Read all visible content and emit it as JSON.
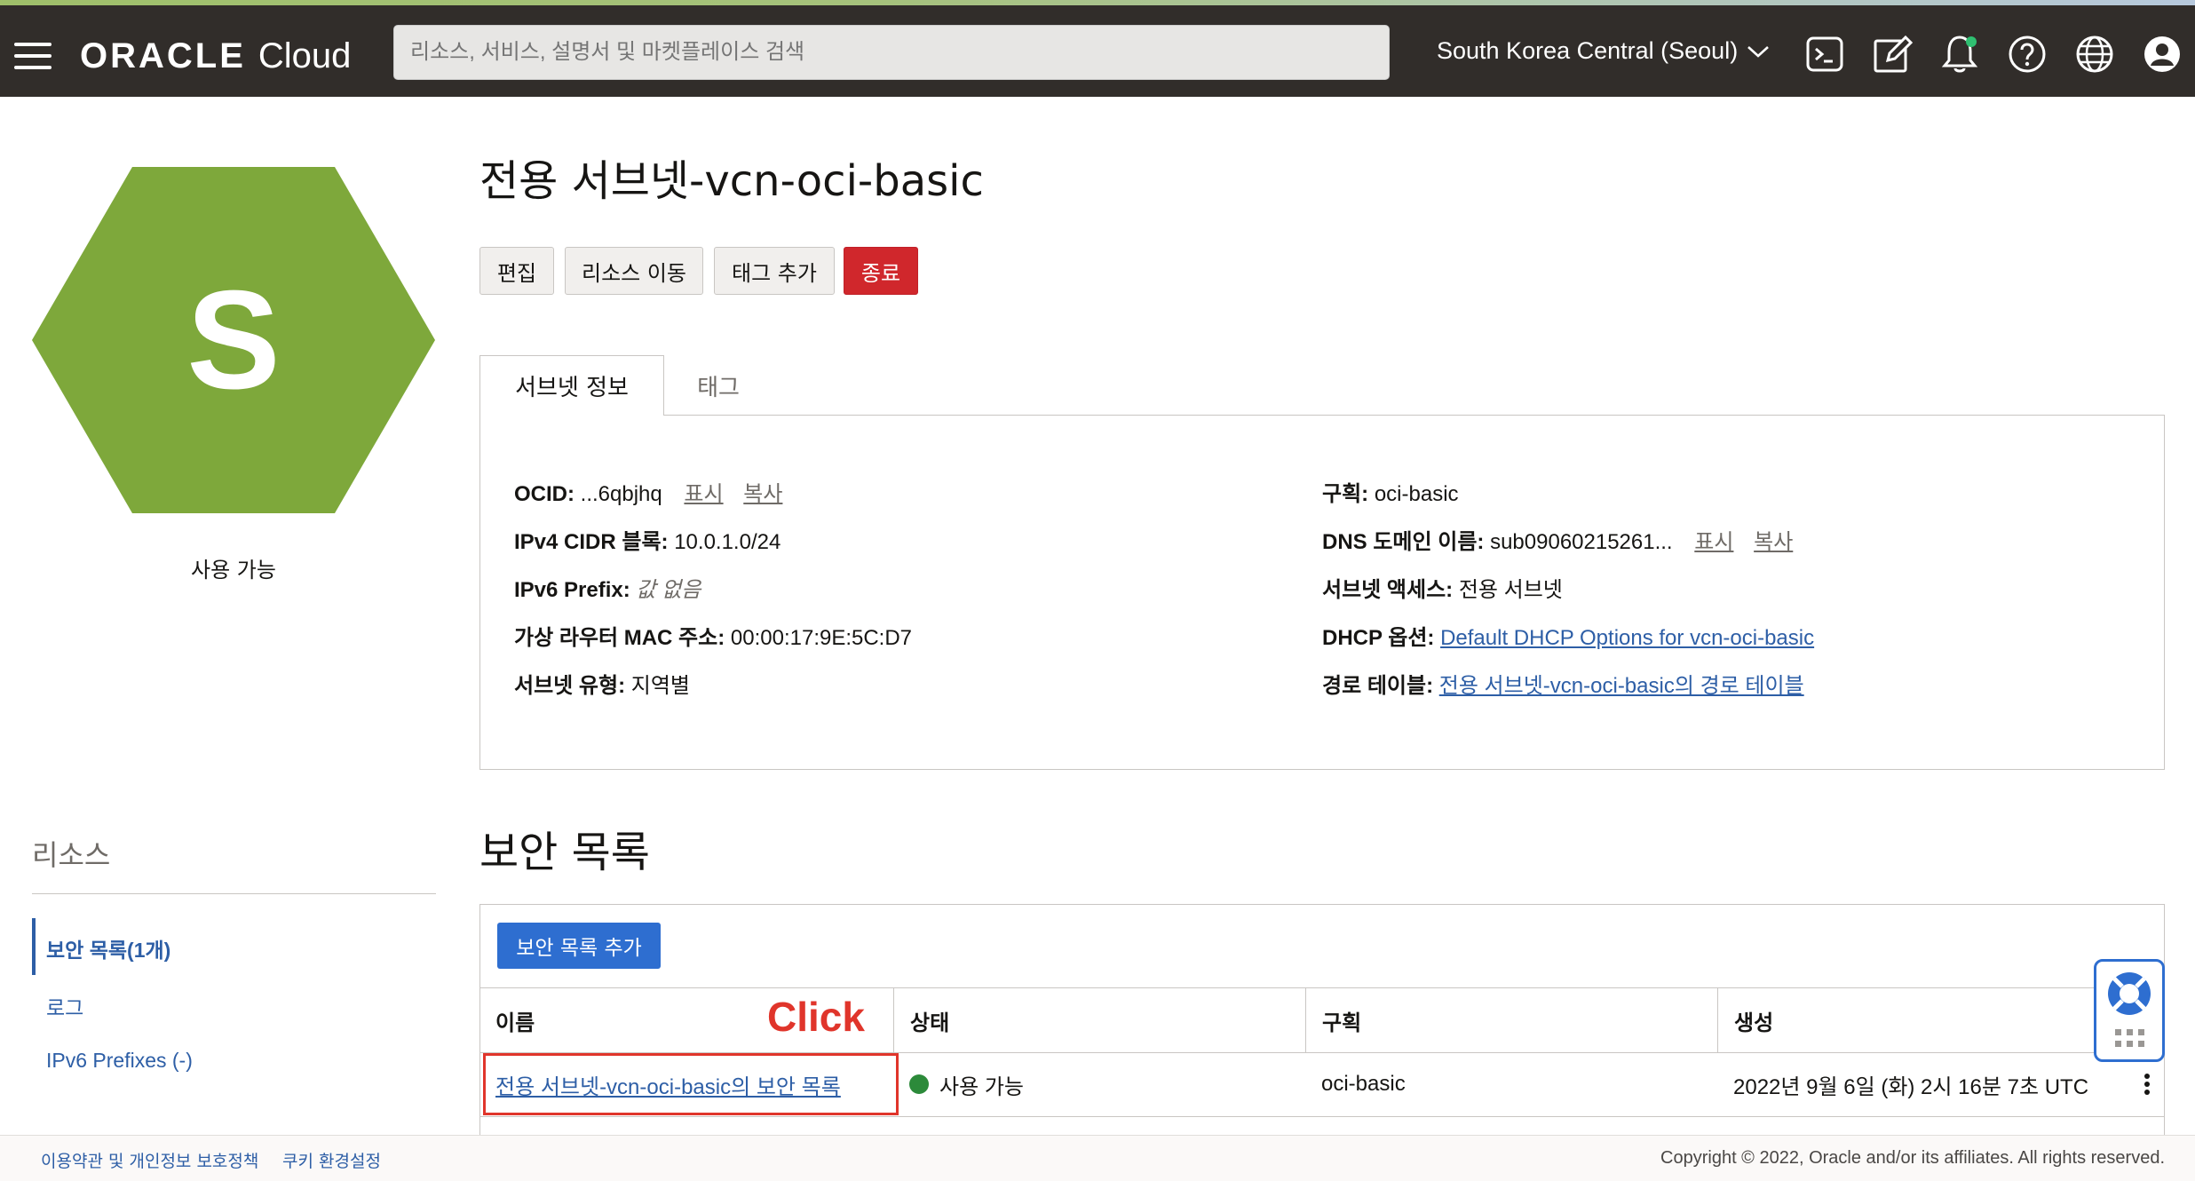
{
  "header": {
    "brand_oracle": "ORACLE",
    "brand_cloud": "Cloud",
    "search_placeholder": "리소스, 서비스, 설명서 및 마켓플레이스 검색",
    "region": "South Korea Central (Seoul)",
    "icons": [
      "cloud-shell-icon",
      "edit-icon",
      "bell-icon",
      "help-icon",
      "globe-icon",
      "user-icon"
    ]
  },
  "summary": {
    "letter": "S",
    "status": "사용 가능",
    "hex_color": "#7ea83b"
  },
  "resources": {
    "heading": "리소스",
    "items": [
      {
        "label": "보안 목록(1개)",
        "active": true
      },
      {
        "label": "로그",
        "active": false
      },
      {
        "label": "IPv6 Prefixes (-)",
        "active": false
      }
    ]
  },
  "page": {
    "title": "전용 서브넷-vcn-oci-basic",
    "actions": {
      "edit": "편집",
      "move": "리소스 이동",
      "add_tags": "태그 추가",
      "terminate": "종료"
    },
    "tabs": {
      "info": "서브넷 정보",
      "tags": "태그"
    }
  },
  "subnet_info": {
    "ocid_label": "OCID:",
    "ocid_value": "...6qbjhq",
    "show": "표시",
    "copy": "복사",
    "ipv4_label": "IPv4 CIDR 블록:",
    "ipv4_value": "10.0.1.0/24",
    "ipv6_label": "IPv6 Prefix:",
    "ipv6_value": "값 없음",
    "mac_label": "가상 라우터 MAC 주소:",
    "mac_value": "00:00:17:9E:5C:D7",
    "type_label": "서브넷 유형:",
    "type_value": "지역별",
    "compartment_label": "구획:",
    "compartment_value": "oci-basic",
    "dns_label": "DNS 도메인 이름:",
    "dns_value": "sub09060215261...",
    "access_label": "서브넷 액세스:",
    "access_value": "전용 서브넷",
    "dhcp_label": "DHCP 옵션:",
    "dhcp_value": "Default DHCP Options for vcn-oci-basic",
    "route_label": "경로 테이블:",
    "route_value": "전용 서브넷-vcn-oci-basic의 경로 테이블"
  },
  "security_lists": {
    "title": "보안 목록",
    "add_button": "보안 목록 추가",
    "click_annotation": "Click",
    "columns": [
      "이름",
      "상태",
      "구획",
      "생성"
    ],
    "rows": [
      {
        "name": "전용 서브넷-vcn-oci-basic의 보안 목록",
        "status": "사용 가능",
        "compartment": "oci-basic",
        "created": "2022년 9월 6일 (화) 2시 16분 7초 UTC"
      }
    ],
    "status_color": "#2c8a3a"
  },
  "footer": {
    "terms": "이용약관 및 개인정보 보호정책",
    "cookies": "쿠키 환경설정",
    "copyright": "Copyright © 2022, Oracle and/or its affiliates. All rights reserved."
  }
}
